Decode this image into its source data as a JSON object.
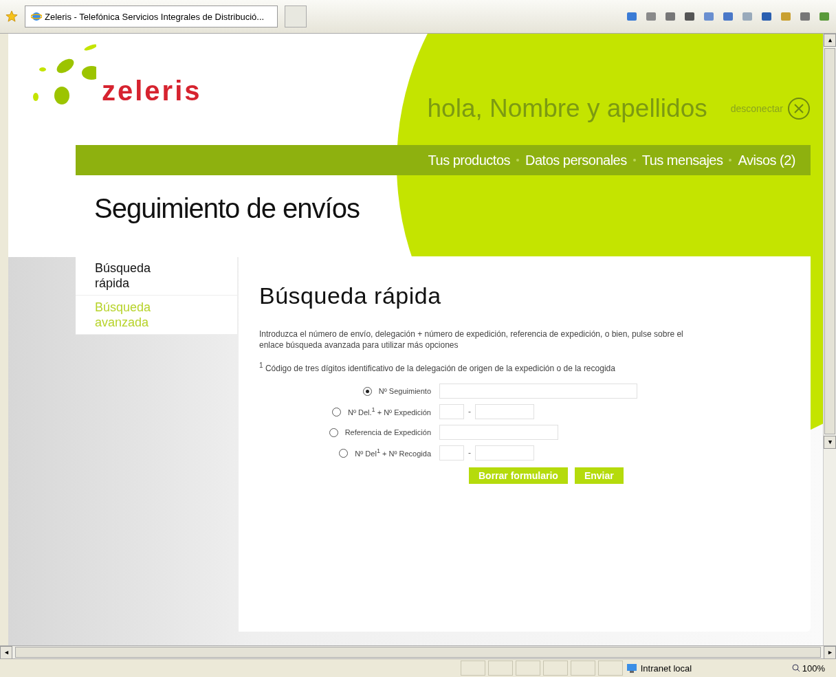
{
  "browser": {
    "tab_title": "Zeleris - Telefónica Servicios Integrales de Distribució..."
  },
  "header": {
    "logo": "zeleris",
    "greeting": "hola, Nombre y apellidos",
    "logout": "desconectar"
  },
  "nav": [
    "Tus productos",
    "Datos personales",
    "Tus mensajes",
    "Avisos (2)"
  ],
  "page_title": "Seguimiento de envíos",
  "sidebar": [
    {
      "label": "Búsqueda rápida",
      "selected": true
    },
    {
      "label": "Búsqueda avanzada",
      "selected": false
    }
  ],
  "panel": {
    "heading": "Búsqueda rápida",
    "intro": "Introduzca el número de envío, delegación + número de expedición, referencia de expedición, o bien, pulse sobre el enlace búsqueda avanzada para utilizar más opciones",
    "footnote": "$^{1}$ Código de tres dígitos identificativo de la delegación de origen de la expedición o de la recogida",
    "rows": [
      {
        "label": "Nº Seguimiento",
        "selected": true,
        "kind": "wide"
      },
      {
        "label": "Nº Del.$^{1}$ + Nº Expedición",
        "selected": false,
        "kind": "pair",
        "separator": "-"
      },
      {
        "label": "Referencia de Expedición",
        "selected": false,
        "kind": "medium"
      },
      {
        "label": "Nº Del$^{1}$ + Nº Recogida",
        "selected": false,
        "kind": "pair",
        "separator": "-"
      }
    ],
    "buttons": [
      "Borrar formulario",
      "Enviar"
    ]
  },
  "status_bar": {
    "zone": "Intranet local",
    "zoom": "100%"
  }
}
